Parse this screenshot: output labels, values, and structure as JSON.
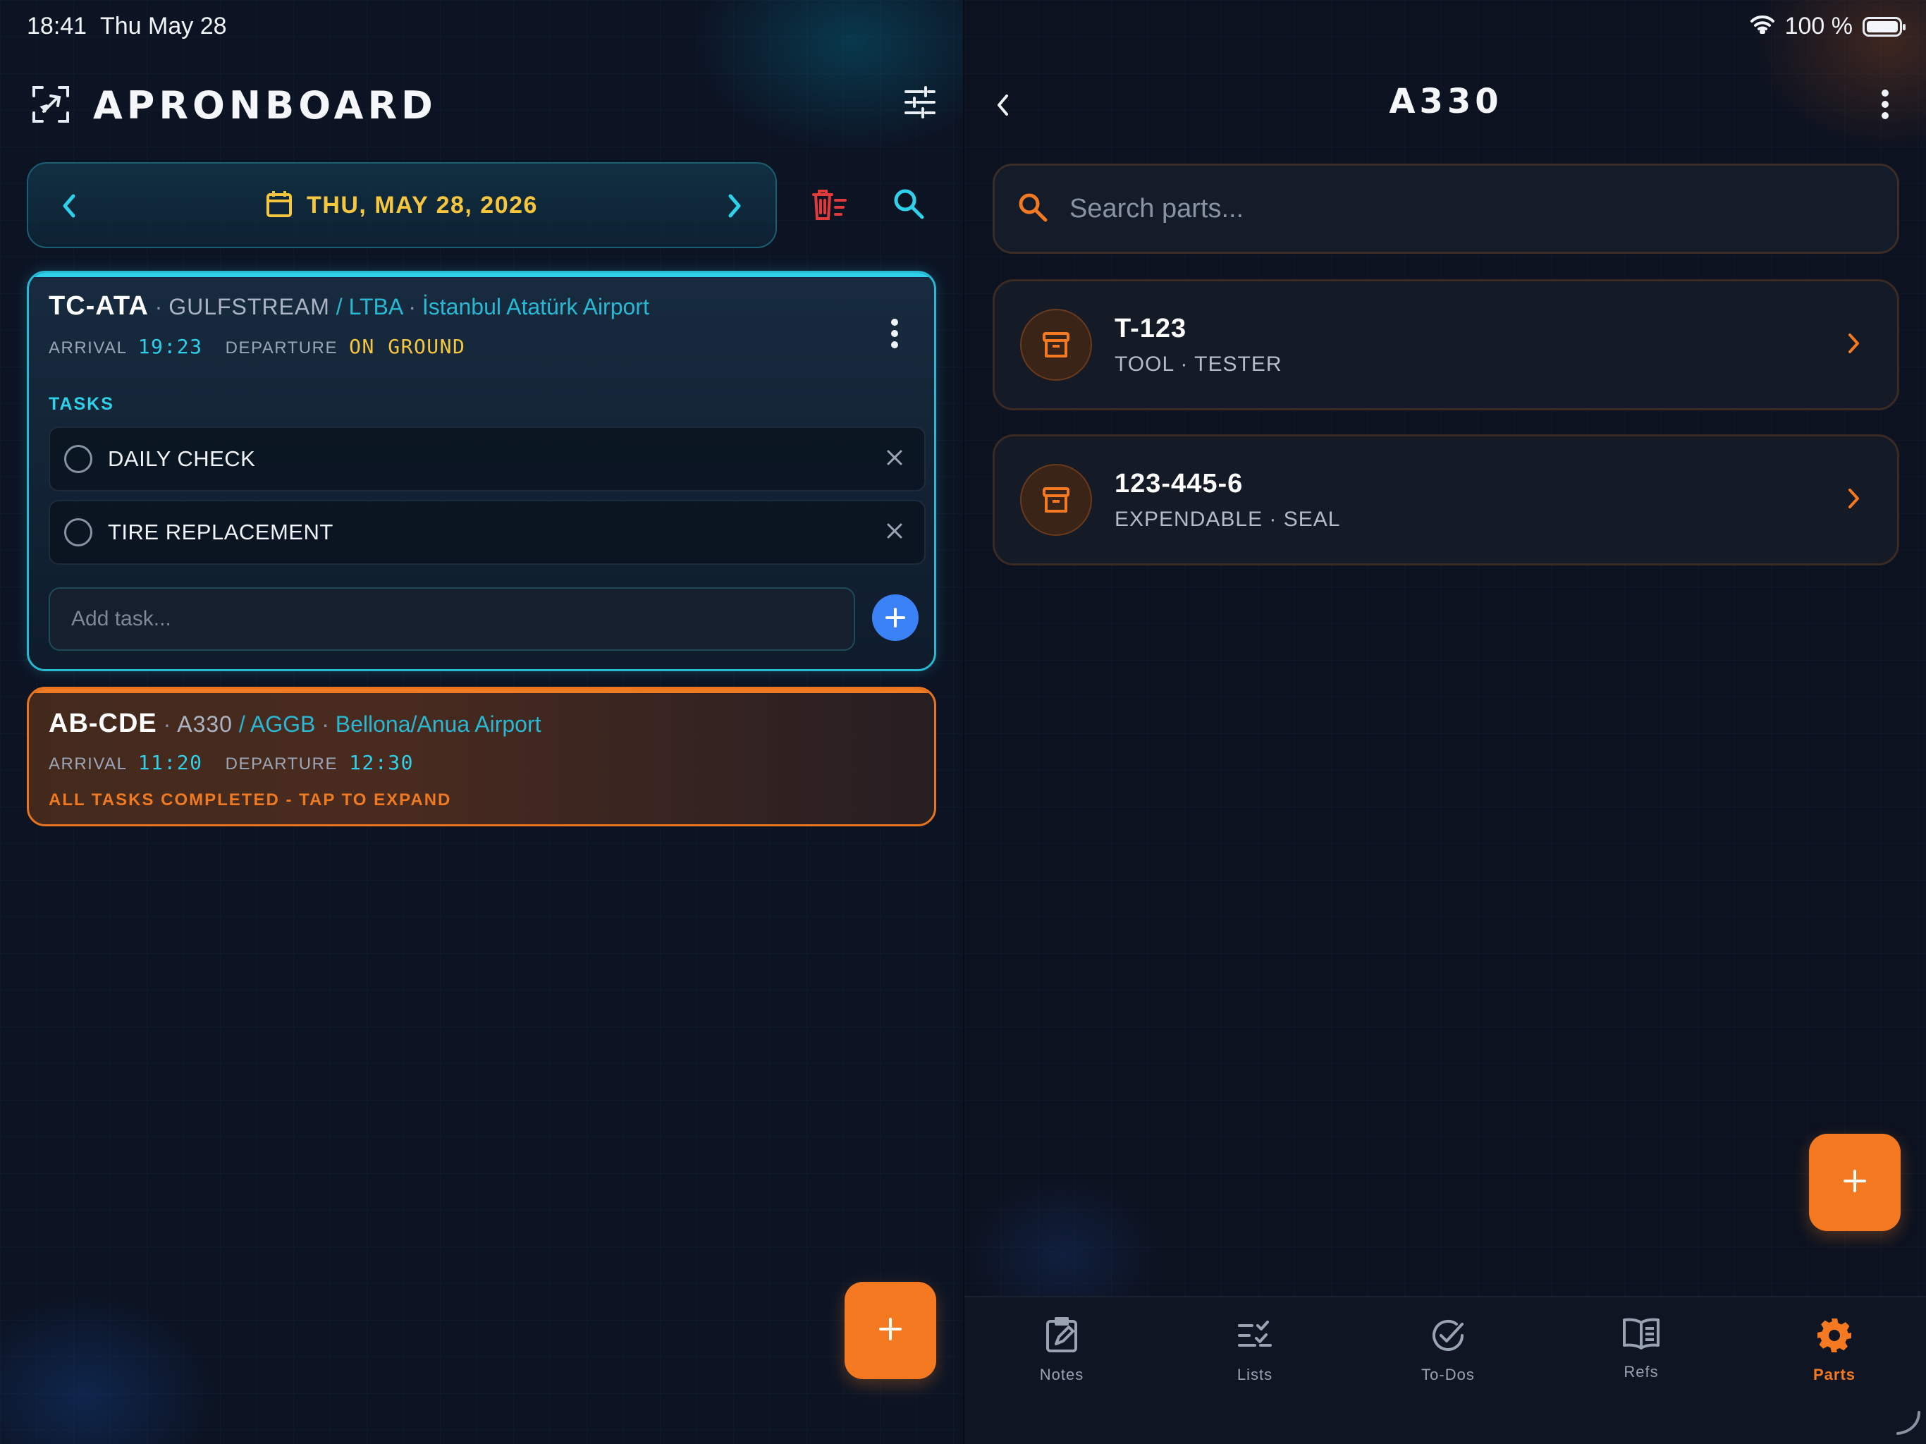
{
  "status_bar": {
    "time": "18:41",
    "date": "Thu May 28",
    "battery": "100 %",
    "battery_level": 1.0
  },
  "left": {
    "app_title": "APRONBOARD",
    "date_label": "THU, MAY 28, 2026",
    "flights": [
      {
        "reg": "TC-ATA",
        "type": "GULFSTREAM",
        "station": "LTBA",
        "airport": "İstanbul Atatürk Airport",
        "arrival_label": "ARRIVAL",
        "arrival": "19:23",
        "departure_label": "DEPARTURE",
        "departure": "ON GROUND",
        "tasks_heading": "TASKS",
        "tasks": [
          {
            "label": "DAILY CHECK",
            "done": false
          },
          {
            "label": "TIRE REPLACEMENT",
            "done": false
          }
        ],
        "add_task_placeholder": "Add task..."
      },
      {
        "reg": "AB-CDE",
        "type": "A330",
        "station": "AGGB",
        "airport": "Bellona/Anua Airport",
        "arrival_label": "ARRIVAL",
        "arrival": "11:20",
        "departure_label": "DEPARTURE",
        "departure": "12:30",
        "completed_note": "ALL TASKS COMPLETED - TAP TO EXPAND"
      }
    ]
  },
  "right": {
    "title": "A330",
    "search_placeholder": "Search parts...",
    "parts": [
      {
        "number": "T-123",
        "category": "TOOL",
        "subtype": "TESTER"
      },
      {
        "number": "123-445-6",
        "category": "EXPENDABLE",
        "subtype": "SEAL"
      }
    ],
    "nav": [
      {
        "label": "Notes",
        "icon": "notes-icon",
        "active": false
      },
      {
        "label": "Lists",
        "icon": "lists-icon",
        "active": false
      },
      {
        "label": "To-Dos",
        "icon": "todos-icon",
        "active": false
      },
      {
        "label": "Refs",
        "icon": "refs-icon",
        "active": false
      },
      {
        "label": "Parts",
        "icon": "gear-icon",
        "active": true
      }
    ]
  },
  "colors": {
    "accent_cyan": "#29b8d4",
    "accent_orange": "#f47920",
    "accent_yellow": "#f5c63e",
    "danger_red": "#e23a3a",
    "add_blue": "#3b82f6"
  }
}
